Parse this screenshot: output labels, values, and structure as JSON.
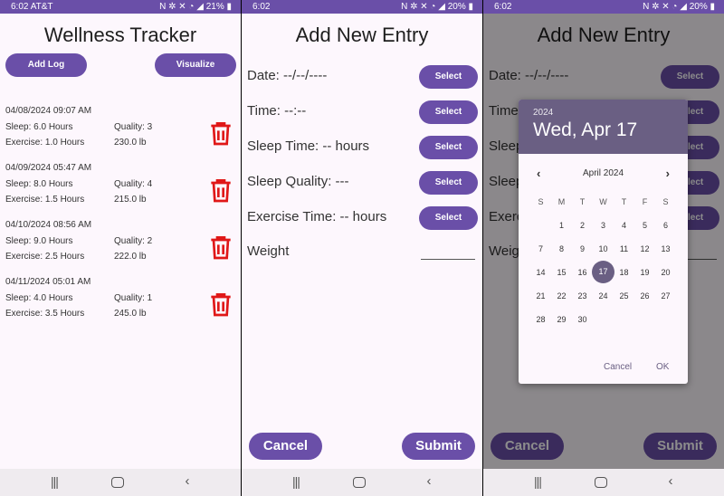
{
  "screen1": {
    "status": {
      "time": "6:02",
      "carrier": "AT&T",
      "icons": "N ✲ ✕ ◔ ◢ 21% ▮"
    },
    "title": "Wellness Tracker",
    "add_log_label": "Add Log",
    "visualize_label": "Visualize",
    "logs": [
      {
        "timestamp": "04/08/2024 09:07 AM",
        "sleep": "Sleep: 6.0 Hours",
        "quality": "Quality: 3",
        "exercise": "Exercise: 1.0 Hours",
        "weight": "230.0 lb"
      },
      {
        "timestamp": "04/09/2024 05:47 AM",
        "sleep": "Sleep: 8.0 Hours",
        "quality": "Quality: 4",
        "exercise": "Exercise: 1.5 Hours",
        "weight": "215.0 lb"
      },
      {
        "timestamp": "04/10/2024 08:56 AM",
        "sleep": "Sleep: 9.0 Hours",
        "quality": "Quality: 2",
        "exercise": "Exercise: 2.5 Hours",
        "weight": "222.0 lb"
      },
      {
        "timestamp": "04/11/2024 05:01 AM",
        "sleep": "Sleep: 4.0 Hours",
        "quality": "Quality: 1",
        "exercise": "Exercise: 3.5 Hours",
        "weight": "245.0 lb"
      }
    ],
    "trash_icon": "trash-icon",
    "trash_color": "#e01818"
  },
  "screen2": {
    "status": {
      "time": "6:02",
      "icons": "N ✲ ✕ ◔ ◢ 20% ▮"
    },
    "title": "Add New Entry",
    "fields": [
      {
        "label": "Date: --/--/----",
        "button": "Select"
      },
      {
        "label": "Time: --:--",
        "button": "Select"
      },
      {
        "label": "Sleep Time: -- hours",
        "button": "Select"
      },
      {
        "label": "Sleep Quality: ---",
        "button": "Select"
      },
      {
        "label": "Exercise Time: -- hours",
        "button": "Select"
      }
    ],
    "weight_label": "Weight",
    "weight_value": "",
    "cancel_label": "Cancel",
    "submit_label": "Submit"
  },
  "screen3": {
    "status": {
      "time": "6:02",
      "icons": "N ✲ ✕ ◔ ◢ 20% ▮"
    },
    "dialog": {
      "year": "2024",
      "selected_date": "Wed, Apr 17",
      "month": "April 2024",
      "weekdays": [
        "S",
        "M",
        "T",
        "W",
        "T",
        "F",
        "S"
      ],
      "first_weekday_index": 1,
      "days_in_month": 30,
      "selected_day": 17,
      "cancel_label": "Cancel",
      "ok_label": "OK"
    }
  },
  "nav": {
    "recent": "|||",
    "back": "‹"
  },
  "colors": {
    "accent": "#6a4fa8",
    "dialog_header": "#6a5f83",
    "background": "#fdf7fd",
    "trash": "#e01818"
  }
}
